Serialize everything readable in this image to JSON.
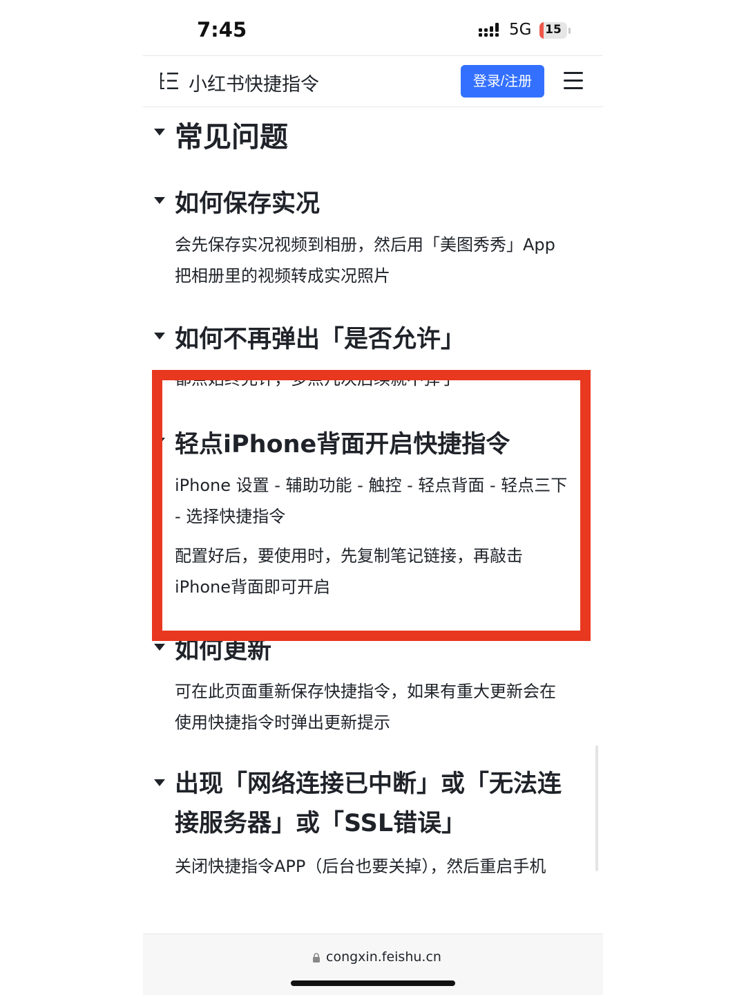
{
  "status_bar": {
    "time": "7:45",
    "network": "5G",
    "battery_level": "15",
    "battery_fraction": 0.15
  },
  "header": {
    "title": "小红书快捷指令",
    "login_label": "登录/注册",
    "outline_icon": "outline-list-icon",
    "menu_icon": "hamburger-menu-icon"
  },
  "content": {
    "main_heading": "常见问题",
    "sections": [
      {
        "heading": "如何保存实况",
        "paragraphs": [
          "会先保存实况视频到相册，然后用「美图秀秀」App 把相册里的视频转成实况照片"
        ]
      },
      {
        "heading": "如何不再弹出「是否允许」",
        "paragraphs": [
          "都点始终允许，多点几次后续就不弹了"
        ]
      },
      {
        "heading": "轻点iPhone背面开启快捷指令",
        "paragraphs": [
          "iPhone 设置 - 辅助功能 - 触控 - 轻点背面 - 轻点三下 - 选择快捷指令",
          "配置好后，要使用时，先复制笔记链接，再敲击iPhone背面即可开启"
        ]
      },
      {
        "heading": "如何更新",
        "paragraphs": [
          "可在此页面重新保存快捷指令，如果有重大更新会在使用快捷指令时弹出更新提示"
        ]
      },
      {
        "heading": "出现「网络连接已中断」或「无法连接服务器」或「SSL错误」",
        "paragraphs": [
          "关闭快捷指令APP（后台也要关掉），然后重启手机"
        ]
      }
    ]
  },
  "bottom_bar": {
    "url": "congxin.feishu.cn",
    "lock_icon": "lock-icon"
  },
  "colors": {
    "primary_button": "#3370ff",
    "highlight_box": "#e8381f",
    "battery_low": "#f0564a",
    "text": "#1f2329"
  }
}
